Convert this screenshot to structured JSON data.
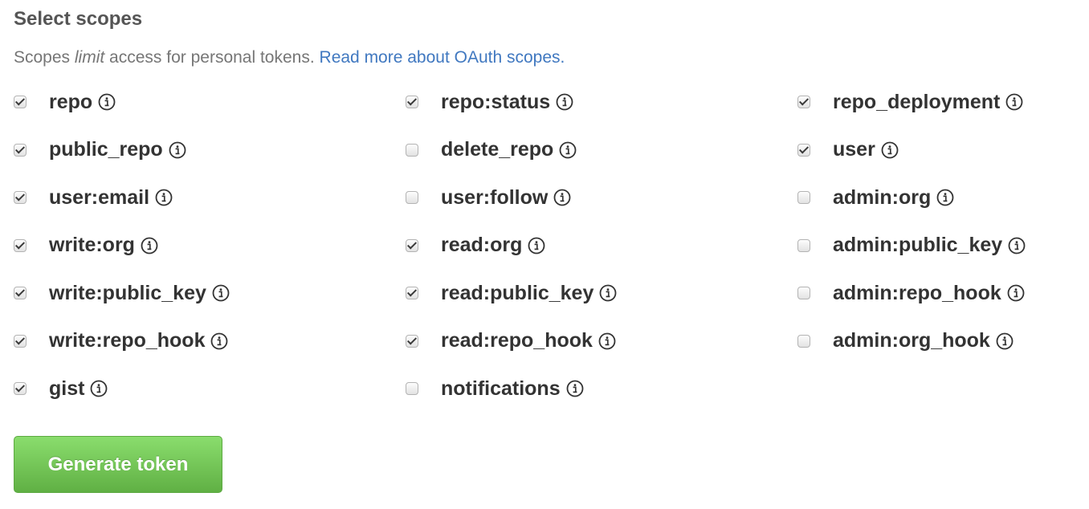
{
  "heading": "Select scopes",
  "description": {
    "prefix": "Scopes ",
    "emphasis": "limit",
    "suffix": " access for personal tokens. ",
    "link": "Read more about OAuth scopes."
  },
  "scopes": [
    {
      "name": "repo",
      "checked": true
    },
    {
      "name": "repo:status",
      "checked": true
    },
    {
      "name": "repo_deployment",
      "checked": true
    },
    {
      "name": "public_repo",
      "checked": true
    },
    {
      "name": "delete_repo",
      "checked": false
    },
    {
      "name": "user",
      "checked": true
    },
    {
      "name": "user:email",
      "checked": true
    },
    {
      "name": "user:follow",
      "checked": false
    },
    {
      "name": "admin:org",
      "checked": false
    },
    {
      "name": "write:org",
      "checked": true
    },
    {
      "name": "read:org",
      "checked": true
    },
    {
      "name": "admin:public_key",
      "checked": false
    },
    {
      "name": "write:public_key",
      "checked": true
    },
    {
      "name": "read:public_key",
      "checked": true
    },
    {
      "name": "admin:repo_hook",
      "checked": false
    },
    {
      "name": "write:repo_hook",
      "checked": true
    },
    {
      "name": "read:repo_hook",
      "checked": true
    },
    {
      "name": "admin:org_hook",
      "checked": false
    },
    {
      "name": "gist",
      "checked": true
    },
    {
      "name": "notifications",
      "checked": false
    }
  ],
  "scope_icon": "info-icon",
  "colors": {
    "link": "#4078c0",
    "button_top": "#8add6d",
    "button_bottom": "#60b044"
  },
  "generate_button": "Generate token"
}
